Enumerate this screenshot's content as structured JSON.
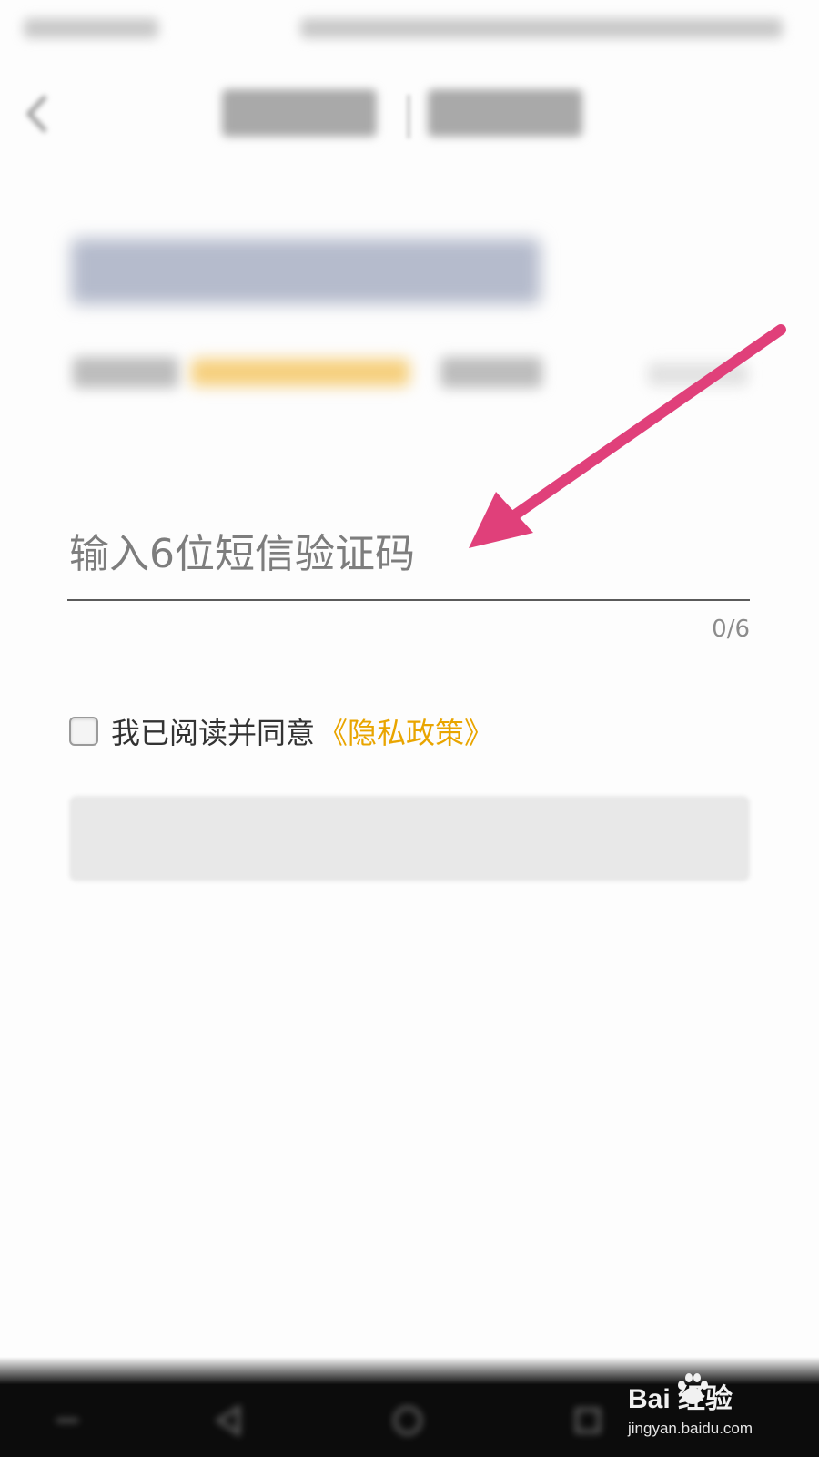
{
  "verification": {
    "code_placeholder": "输入6位短信验证码",
    "code_value": "",
    "counter": "0/6"
  },
  "agreement": {
    "text": "我已阅读并同意",
    "policy_link": "《隐私政策》",
    "checked": false
  },
  "colors": {
    "accent": "#e9a500",
    "annotation_arrow": "#e0407a",
    "input_underline": "#5a5a5a",
    "nav_bar": "#0c0c0c"
  },
  "watermark": {
    "logo": "Bai 经验",
    "url": "jingyan.baidu.com"
  },
  "icons": [
    "back-icon",
    "nav-back-icon",
    "nav-home-icon",
    "nav-recents-icon",
    "nav-menu-icon",
    "baidu-paw-icon"
  ]
}
